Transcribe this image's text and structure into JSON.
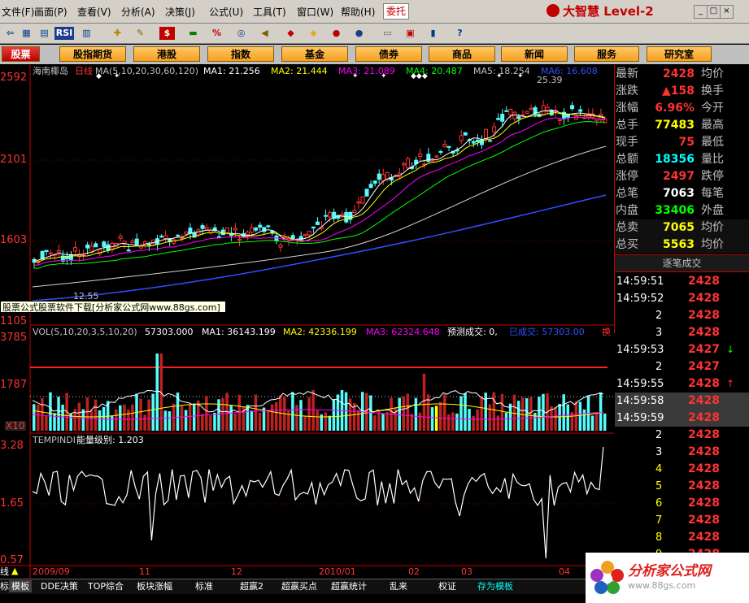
{
  "menubar": {
    "items": [
      "文件(F)",
      "画面(P)",
      "查看(V)",
      "分析(A)",
      "决策(J)",
      "公式(U)",
      "工具(T)",
      "窗口(W)",
      "帮助(H)"
    ],
    "entrust_label": "委托",
    "brand": "大智慧 Level-2"
  },
  "nav": {
    "items": [
      "股票",
      "股指期货",
      "港股",
      "指数",
      "基金",
      "债券",
      "商品",
      "新闻",
      "服务",
      "研究室"
    ],
    "active": "股票"
  },
  "toolbar": {
    "rsi_label": "RSI"
  },
  "chart": {
    "stock_name": "海南椰岛",
    "period": "日线",
    "ma_header": "MA(5,10,20,30,60,120)",
    "ma_values": [
      {
        "label": "MA1: 21.256",
        "color": "#ffffff"
      },
      {
        "label": "MA2: 21.444",
        "color": "#ffff00"
      },
      {
        "label": "MA3: 21.089",
        "color": "#ff00ff"
      },
      {
        "label": "MA4: 20.487",
        "color": "#00ff00"
      },
      {
        "label": "MA5: 18.254",
        "color": "#c0c0c0"
      },
      {
        "label": "MA6: 16.608",
        "color": "#3050ff"
      }
    ],
    "price_axis": [
      "2592",
      "2101",
      "1603",
      "1105"
    ],
    "low_label": "12.55",
    "high_label": "25.39",
    "ad_banner": "股票公式股票软件下载[分析家公式网www.88gs.com]",
    "vol_header": "VOL(5,10,20,3,5,10,20)",
    "vol_value": "57303.000",
    "vol_ma": [
      {
        "label": "MA1: 36143.199",
        "color": "#ffffff"
      },
      {
        "label": "MA2: 42336.199",
        "color": "#ffff00"
      },
      {
        "label": "MA3: 62324.648",
        "color": "#ff00ff"
      },
      {
        "label": "预测成交: 0,",
        "color": "#ffffff"
      },
      {
        "label": "已成交: 57303.00",
        "color": "#3050ff"
      },
      {
        "label": "换",
        "color": "#ff3232"
      }
    ],
    "vol_axis": [
      "3785",
      "1787"
    ],
    "vol_unit": "X10",
    "ind_header": "TEMPINDI",
    "ind_value": "能量级别: 1.203",
    "ind_axis": [
      "3.28",
      "1.65",
      "0.57"
    ],
    "x_labels": [
      "2009/09",
      "11",
      "12",
      "2010/01",
      "02",
      "03",
      "04"
    ],
    "line_mode": "线"
  },
  "quote": {
    "rows": [
      {
        "l1": "最新",
        "v1": "2428",
        "c1": "#ff3232",
        "l2": "均价"
      },
      {
        "l1": "涨跌",
        "v1": "▲158",
        "c1": "#ff3232",
        "l2": "换手"
      },
      {
        "l1": "涨幅",
        "v1": "6.96%",
        "c1": "#ff3232",
        "l2": "今开"
      },
      {
        "l1": "总手",
        "v1": "77483",
        "c1": "#ffff00",
        "l2": "最高"
      },
      {
        "l1": "现手",
        "v1": "75",
        "c1": "#ff3232",
        "l2": "最低"
      },
      {
        "l1": "总额",
        "v1": "18356",
        "c1": "#00ffff",
        "l2": "量比"
      },
      {
        "l1": "涨停",
        "v1": "2497",
        "c1": "#ff3232",
        "l2": "跌停"
      },
      {
        "l1": "总笔",
        "v1": "7063",
        "c1": "#ffffff",
        "l2": "每笔"
      },
      {
        "l1": "内盘",
        "v1": "33406",
        "c1": "#00ff00",
        "l2": "外盘"
      },
      {
        "l1": "总卖",
        "v1": "7065",
        "c1": "#ffff00",
        "l2": "均价"
      },
      {
        "l1": "总买",
        "v1": "5563",
        "c1": "#ffff00",
        "l2": "均价"
      }
    ]
  },
  "ticks": {
    "title": "逐笔成交",
    "rows": [
      {
        "time": "14:59:51",
        "price": "2428",
        "arrow": ""
      },
      {
        "time": "14:59:52",
        "price": "2428",
        "arrow": ""
      },
      {
        "time": "2",
        "price": "2428",
        "arrow": ""
      },
      {
        "time": "3",
        "price": "2428",
        "arrow": ""
      },
      {
        "time": "14:59:53",
        "price": "2427",
        "arrow": "↓"
      },
      {
        "time": "2",
        "price": "2427",
        "arrow": ""
      },
      {
        "time": "14:59:55",
        "price": "2428",
        "arrow": "↑"
      },
      {
        "time": "14:59:58",
        "price": "2428",
        "arrow": ""
      },
      {
        "time": "14:59:59",
        "price": "2428",
        "arrow": ""
      },
      {
        "time": "2",
        "price": "2428",
        "arrow": ""
      },
      {
        "time": "3",
        "price": "2428",
        "arrow": ""
      },
      {
        "time": "4",
        "price": "2428",
        "arrow": ""
      },
      {
        "time": "5",
        "price": "2428",
        "arrow": ""
      },
      {
        "time": "6",
        "price": "2428",
        "arrow": ""
      },
      {
        "time": "7",
        "price": "2428",
        "arrow": ""
      },
      {
        "time": "8",
        "price": "2428",
        "arrow": ""
      },
      {
        "time": "9",
        "price": "2428",
        "arrow": ""
      }
    ]
  },
  "bottom_tabs": [
    "标",
    "模板",
    "DDE决策",
    "TOP综合",
    "板块涨幅",
    "标准",
    "超赢2",
    "超赢买点",
    "超赢统计",
    "乱来",
    "权证",
    "存为模板"
  ],
  "watermark": {
    "title": "分析家公式网",
    "subtitle": "www.88gs.com"
  }
}
